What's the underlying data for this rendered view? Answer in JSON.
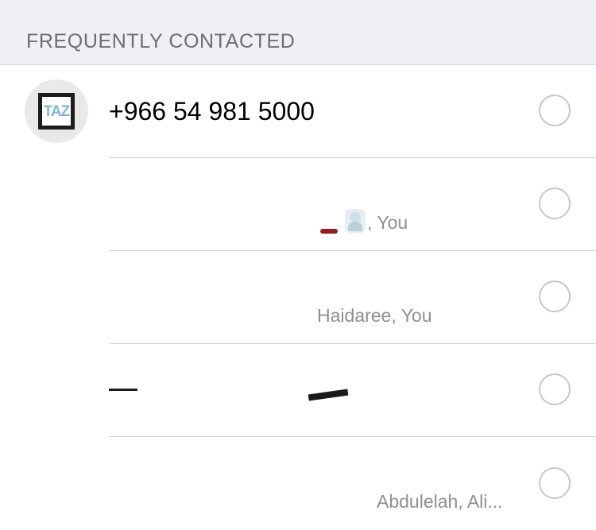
{
  "section": {
    "title": "FREQUENTLY CONTACTED"
  },
  "contacts": [
    {
      "name": "+966 54 981 5000",
      "avatar_text": "TAZ",
      "subtitle": "",
      "selected": false
    },
    {
      "name": "",
      "subtitle": ", You",
      "selected": false
    },
    {
      "name": "",
      "subtitle": "Haidaree, You",
      "selected": false
    },
    {
      "name": "",
      "subtitle": "",
      "selected": false
    },
    {
      "name": "",
      "subtitle": "Abdulelah, Ali...",
      "selected": false
    }
  ],
  "icons": {
    "select": "radio-circle-icon",
    "group_member": "person-emoji-icon"
  },
  "colors": {
    "header_bg": "#efeff4",
    "header_text": "#6d6d72",
    "subtitle_text": "#8e8e93",
    "circle_border": "#c7c7cc"
  }
}
